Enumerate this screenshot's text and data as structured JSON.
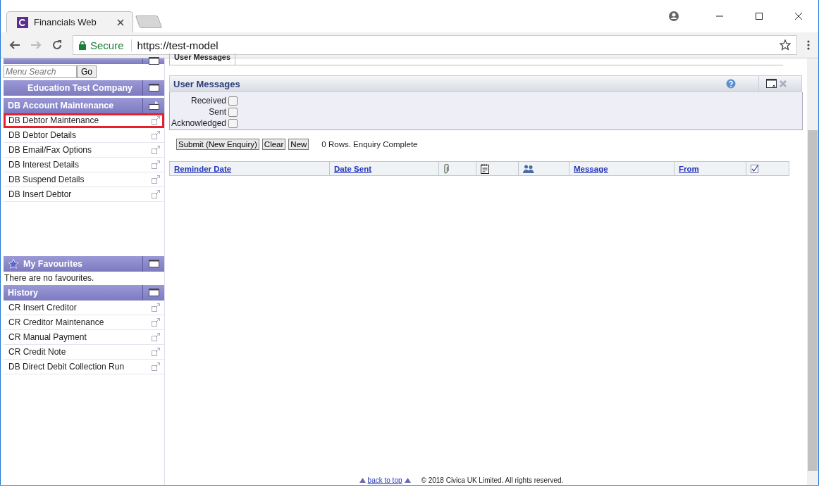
{
  "browser": {
    "tab_title": "Financials Web",
    "secure_label": "Secure",
    "url": "https://test-model"
  },
  "sidebar": {
    "search": {
      "placeholder": "Menu Search",
      "button": "Go"
    },
    "company": "Education Test Company",
    "section": {
      "title": "DB Account Maintenance",
      "items": [
        {
          "label": "DB Debtor Maintenance",
          "highlighted": true
        },
        {
          "label": "DB Debtor Details",
          "highlighted": false
        },
        {
          "label": "DB Email/Fax Options",
          "highlighted": false
        },
        {
          "label": "DB Interest Details",
          "highlighted": false
        },
        {
          "label": "DB Suspend Details",
          "highlighted": false
        },
        {
          "label": "DB Insert Debtor",
          "highlighted": false
        }
      ]
    },
    "favourites": {
      "title": "My Favourites",
      "empty_text": "There are no favourites."
    },
    "history": {
      "title": "History",
      "items": [
        "CR Insert Creditor",
        "CR Creditor Maintenance",
        "CR Manual Payment",
        "CR Credit Note",
        "DB Direct Debit Collection Run"
      ]
    }
  },
  "main": {
    "tab": "User Messages",
    "panel_title": "User Messages",
    "filters": [
      {
        "label": "Received",
        "checked": false
      },
      {
        "label": "Sent",
        "checked": false
      },
      {
        "label": "Acknowledged",
        "checked": false
      }
    ],
    "buttons": [
      "Submit (New Enquiry)",
      "Clear",
      "New"
    ],
    "status": "0 Rows. Enquiry Complete",
    "columns": [
      {
        "kind": "link",
        "label": "Reminder Date"
      },
      {
        "kind": "link",
        "label": "Date Sent"
      },
      {
        "kind": "paperclip"
      },
      {
        "kind": "notepad"
      },
      {
        "kind": "people"
      },
      {
        "kind": "link",
        "label": "Message"
      },
      {
        "kind": "link",
        "label": "From"
      },
      {
        "kind": "tick"
      }
    ]
  },
  "footer": {
    "back_to_top": "back to top",
    "copyright": "© 2018 Civica UK Limited. All rights reserved."
  }
}
